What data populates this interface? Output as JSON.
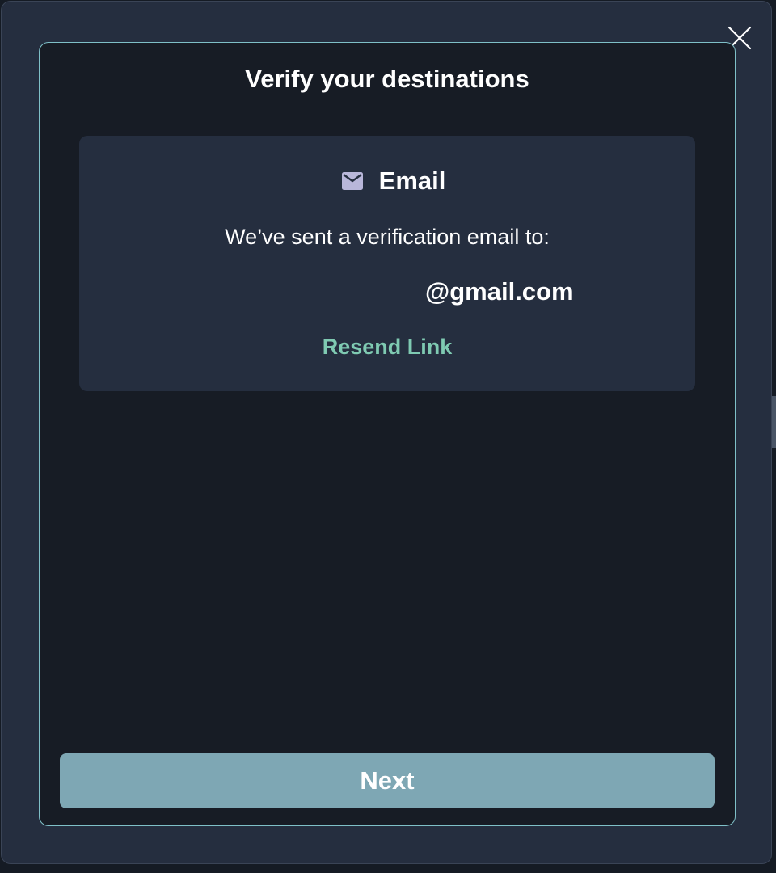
{
  "dialog": {
    "title": "Verify your destinations",
    "close_icon": "close-icon",
    "colors": {
      "outer_background": "#252e3f",
      "inner_background": "#171c25",
      "inner_border": "#7fc0c8",
      "accent": "#7fcab2",
      "button": "#7ea7b4"
    }
  },
  "email_card": {
    "icon": "mail-icon",
    "heading": "Email",
    "message": "We’ve sent a verification email to:",
    "address": "@gmail.com",
    "resend_label": "Resend Link"
  },
  "footer": {
    "next_label": "Next"
  }
}
